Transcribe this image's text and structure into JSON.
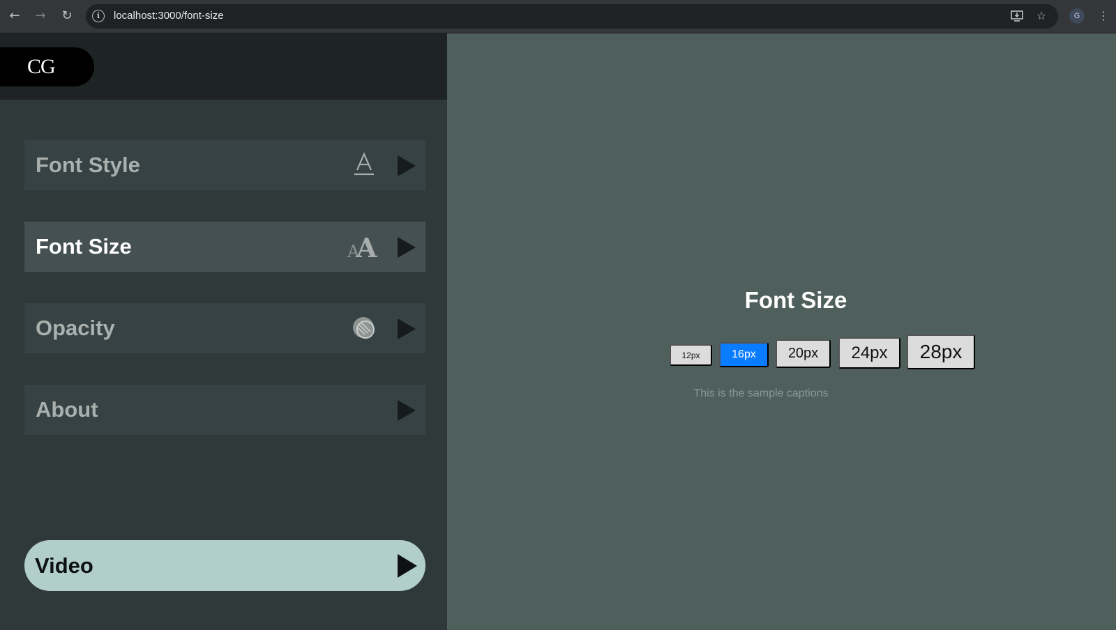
{
  "browser": {
    "url": "localhost:3000/font-size",
    "avatar_letter": "G",
    "icons": [
      "back-arrow-icon",
      "forward-arrow-icon",
      "reload-icon",
      "site-info-icon",
      "install-app-icon",
      "bookmark-star-icon",
      "more-menu-icon"
    ]
  },
  "sidebar": {
    "logo": "CG",
    "items": [
      {
        "label": "Font Style",
        "icon": "font-style-icon",
        "active": false
      },
      {
        "label": "Font Size",
        "icon": "font-size-icon",
        "active": true
      },
      {
        "label": "Opacity",
        "icon": "opacity-icon",
        "active": false
      },
      {
        "label": "About",
        "icon": "",
        "active": false
      }
    ],
    "video_label": "Video"
  },
  "main": {
    "title": "Font Size",
    "sizes": [
      "12px",
      "16px",
      "20px",
      "24px",
      "28px"
    ],
    "selected_size": "16px",
    "caption": "This is the sample captions"
  },
  "colors": {
    "sidebar_bg": "#2f393a",
    "main_bg": "#4f5f5c",
    "accent": "#0a7cff",
    "video_button": "#b1cecb"
  }
}
